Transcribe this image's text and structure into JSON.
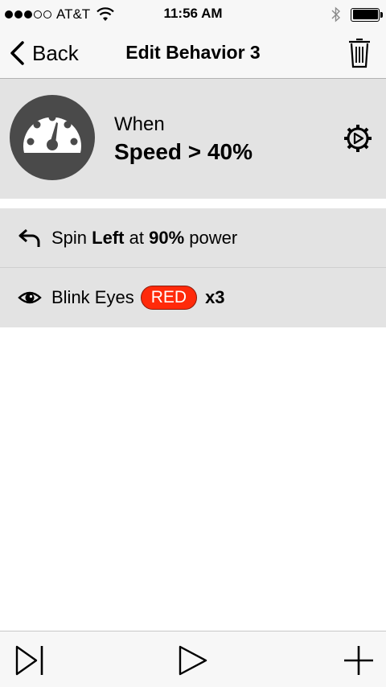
{
  "status_bar": {
    "carrier": "AT&T",
    "time": "11:56 AM",
    "signal_strength": 3,
    "signal_total": 5,
    "battery_level": 1.0
  },
  "nav": {
    "back_label": "Back",
    "title": "Edit Behavior 3"
  },
  "trigger": {
    "prefix": "When",
    "condition": "Speed > 40%",
    "icon": "speedometer-icon"
  },
  "actions": [
    {
      "icon": "turn-left-arrow-icon",
      "verb": "Spin",
      "direction": "Left",
      "connector": "at",
      "power": "90%",
      "suffix": "power"
    },
    {
      "icon": "eye-icon",
      "verb": "Blink Eyes",
      "color_label": "RED",
      "color": "#ff2a0a",
      "repeat": "x3"
    }
  ],
  "toolbar": {
    "items": [
      "step-forward-icon",
      "play-icon",
      "plus-icon"
    ]
  }
}
